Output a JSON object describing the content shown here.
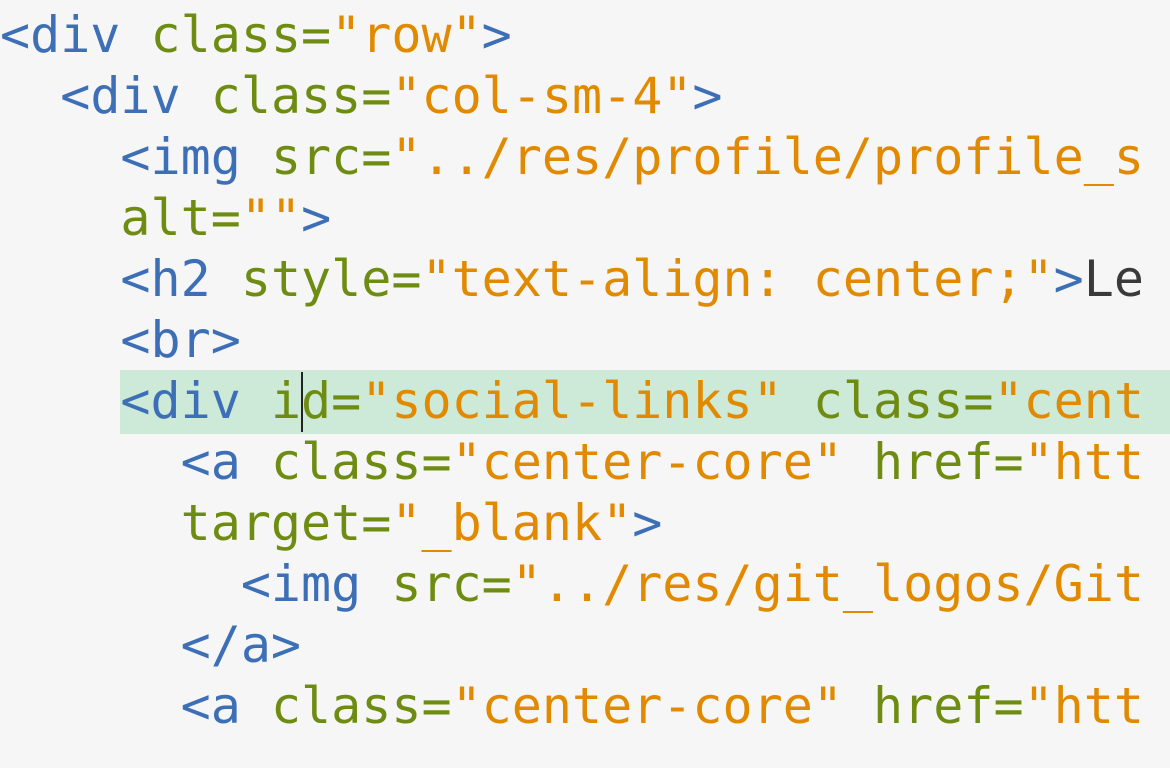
{
  "editor": {
    "language": "html",
    "current_line": 7,
    "colors": {
      "background": "#f6f6f6",
      "tag": "#3d6fb7",
      "attribute": "#6e8c12",
      "string": "#e18a00",
      "text": "#3a3a3a",
      "current_line_highlight": "#cde9d7"
    },
    "lines": [
      [
        {
          "t": "tag",
          "v": "<div"
        },
        {
          "t": "text",
          "v": " "
        },
        {
          "t": "attr",
          "v": "class"
        },
        {
          "t": "eq",
          "v": "="
        },
        {
          "t": "str",
          "v": "\"row\""
        },
        {
          "t": "tag",
          "v": ">"
        }
      ],
      [
        {
          "t": "text",
          "v": "  "
        },
        {
          "t": "tag",
          "v": "<div"
        },
        {
          "t": "text",
          "v": " "
        },
        {
          "t": "attr",
          "v": "class"
        },
        {
          "t": "eq",
          "v": "="
        },
        {
          "t": "str",
          "v": "\"col-sm-4\""
        },
        {
          "t": "tag",
          "v": ">"
        }
      ],
      [
        {
          "t": "text",
          "v": "    "
        },
        {
          "t": "tag",
          "v": "<img"
        },
        {
          "t": "text",
          "v": " "
        },
        {
          "t": "attr",
          "v": "src"
        },
        {
          "t": "eq",
          "v": "="
        },
        {
          "t": "str",
          "v": "\"../res/profile/profile_s"
        }
      ],
      [
        {
          "t": "text",
          "v": "    "
        },
        {
          "t": "attr",
          "v": "alt"
        },
        {
          "t": "eq",
          "v": "="
        },
        {
          "t": "str",
          "v": "\"\""
        },
        {
          "t": "tag",
          "v": ">"
        }
      ],
      [
        {
          "t": "text",
          "v": "    "
        },
        {
          "t": "tag",
          "v": "<h2"
        },
        {
          "t": "text",
          "v": " "
        },
        {
          "t": "attr",
          "v": "style"
        },
        {
          "t": "eq",
          "v": "="
        },
        {
          "t": "str",
          "v": "\"text-align: center;\""
        },
        {
          "t": "tag",
          "v": ">"
        },
        {
          "t": "text",
          "v": "Le"
        }
      ],
      [
        {
          "t": "text",
          "v": "    "
        },
        {
          "t": "tag",
          "v": "<br>"
        }
      ],
      [
        {
          "t": "text",
          "v": "    "
        },
        {
          "t": "tag",
          "v": "<div"
        },
        {
          "t": "text",
          "v": " "
        },
        {
          "t": "attr",
          "v": "id"
        },
        {
          "t": "eq",
          "v": "="
        },
        {
          "t": "str",
          "v": "\"social-links\""
        },
        {
          "t": "text",
          "v": " "
        },
        {
          "t": "attr",
          "v": "class"
        },
        {
          "t": "eq",
          "v": "="
        },
        {
          "t": "str",
          "v": "\"cent"
        }
      ],
      [
        {
          "t": "text",
          "v": "      "
        },
        {
          "t": "tag",
          "v": "<a"
        },
        {
          "t": "text",
          "v": " "
        },
        {
          "t": "attr",
          "v": "class"
        },
        {
          "t": "eq",
          "v": "="
        },
        {
          "t": "str",
          "v": "\"center-core\""
        },
        {
          "t": "text",
          "v": " "
        },
        {
          "t": "attr",
          "v": "href"
        },
        {
          "t": "eq",
          "v": "="
        },
        {
          "t": "str",
          "v": "\"htt"
        }
      ],
      [
        {
          "t": "text",
          "v": "      "
        },
        {
          "t": "attr",
          "v": "target"
        },
        {
          "t": "eq",
          "v": "="
        },
        {
          "t": "str",
          "v": "\"_blank\""
        },
        {
          "t": "tag",
          "v": ">"
        }
      ],
      [
        {
          "t": "text",
          "v": "        "
        },
        {
          "t": "tag",
          "v": "<img"
        },
        {
          "t": "text",
          "v": " "
        },
        {
          "t": "attr",
          "v": "src"
        },
        {
          "t": "eq",
          "v": "="
        },
        {
          "t": "str",
          "v": "\"../res/git_logos/Git"
        }
      ],
      [
        {
          "t": "text",
          "v": "      "
        },
        {
          "t": "tag",
          "v": "</a>"
        }
      ],
      [
        {
          "t": "text",
          "v": "      "
        },
        {
          "t": "tag",
          "v": "<a"
        },
        {
          "t": "text",
          "v": " "
        },
        {
          "t": "attr",
          "v": "class"
        },
        {
          "t": "eq",
          "v": "="
        },
        {
          "t": "str",
          "v": "\"center-core\""
        },
        {
          "t": "text",
          "v": " "
        },
        {
          "t": "attr",
          "v": "href"
        },
        {
          "t": "eq",
          "v": "="
        },
        {
          "t": "str",
          "v": "\"htt"
        }
      ]
    ]
  }
}
